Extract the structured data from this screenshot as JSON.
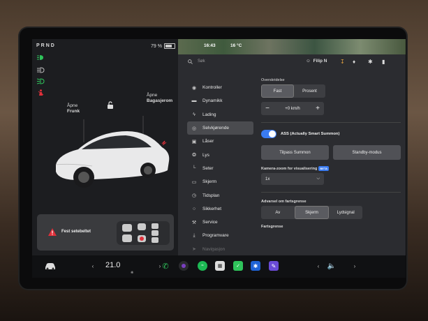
{
  "status": {
    "gear_selector": "PRND",
    "battery": "79 %",
    "battery_level": 0.79
  },
  "vehicle": {
    "frunk_label_top": "Åpne",
    "frunk_label_bottom": "Frunk",
    "trunk_label_top": "Åpne",
    "trunk_label_bottom": "Bagasjerom",
    "alert_text": "Fest setebeltet"
  },
  "map_strip": {
    "time": "16:43",
    "temperature": "16 °C"
  },
  "topbar": {
    "search_placeholder": "Søk",
    "user_name": "Filip N"
  },
  "menu": {
    "items": [
      {
        "label": "Kontroller",
        "icon": "toggle-icon"
      },
      {
        "label": "Dynamikk",
        "icon": "car-icon"
      },
      {
        "label": "Lading",
        "icon": "bolt-icon"
      },
      {
        "label": "Selvkjørende",
        "icon": "steering-icon"
      },
      {
        "label": "Låser",
        "icon": "lock-icon"
      },
      {
        "label": "Lys",
        "icon": "bulb-icon"
      },
      {
        "label": "Seter",
        "icon": "seat-icon"
      },
      {
        "label": "Skjerm",
        "icon": "display-icon"
      },
      {
        "label": "Tidsplan",
        "icon": "clock-icon"
      },
      {
        "label": "Sikkerhet",
        "icon": "shield-icon"
      },
      {
        "label": "Service",
        "icon": "wrench-icon"
      },
      {
        "label": "Programvare",
        "icon": "download-icon"
      },
      {
        "label": "Navigasjon",
        "icon": "nav-icon"
      }
    ],
    "active_index": 3
  },
  "settings": {
    "overspeed_title": "Overskridelse",
    "overspeed_options": [
      "Fast",
      "Prosent"
    ],
    "overspeed_selected": "Fast",
    "offset_value": "+0 km/h",
    "ass_label": "ASS (Actually Smart Summon)",
    "ass_enabled": true,
    "summon_button": "Tilpass Summon",
    "standby_button": "Standby-modus",
    "camera_zoom_title": "Kamera-zoom for visualisering",
    "camera_zoom_badge": "BETA",
    "camera_zoom_value": "1x",
    "speed_warning_title": "Advarsel om fartsgrense",
    "speed_warning_options": [
      "Av",
      "Skjerm",
      "Lydsignal"
    ],
    "speed_warning_selected": "Skjerm",
    "speed_limit_title": "Fartsgrense"
  },
  "dock": {
    "temperature": "21.0",
    "temp_unit_glyph": "°"
  },
  "colors": {
    "accent_blue": "#3a7bf0",
    "alert_red": "#e0303a",
    "indicator_green": "#2fc35b"
  }
}
